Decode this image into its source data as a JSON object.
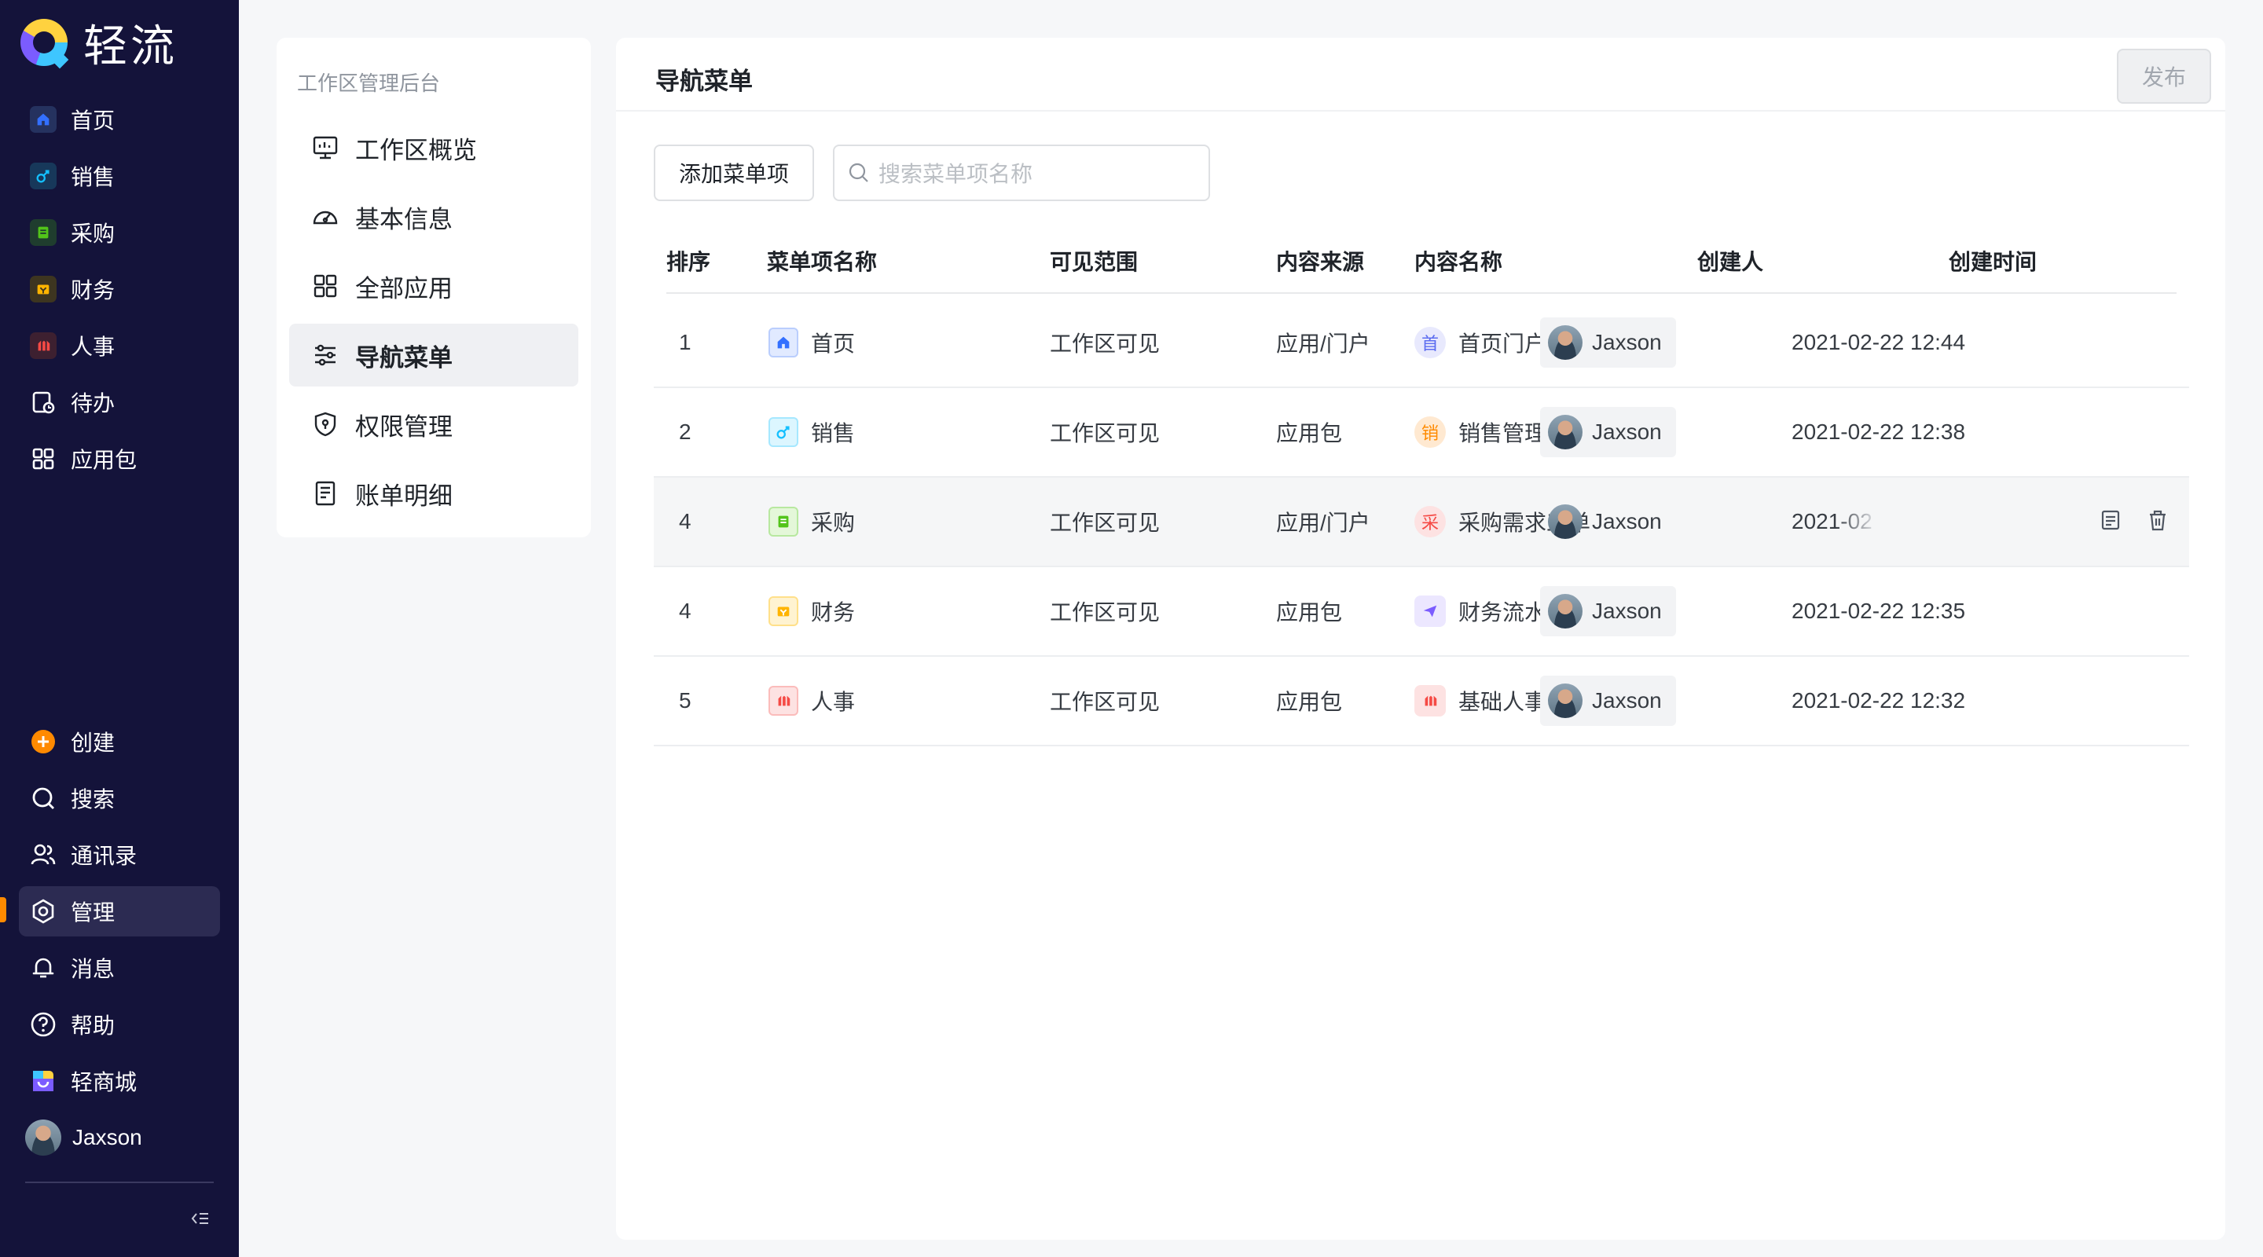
{
  "app": {
    "name": "轻流"
  },
  "sidebar": {
    "top_items": [
      {
        "label": "首页",
        "icon": "home-icon",
        "color": "#3370ff"
      },
      {
        "label": "销售",
        "icon": "sales-icon",
        "color": "#14c0ff"
      },
      {
        "label": "采购",
        "icon": "purchase-icon",
        "color": "#52c41a"
      },
      {
        "label": "财务",
        "icon": "finance-icon",
        "color": "#ffb400"
      },
      {
        "label": "人事",
        "icon": "hr-icon",
        "color": "#f54a45"
      },
      {
        "label": "待办",
        "icon": "todo-icon"
      },
      {
        "label": "应用包",
        "icon": "app-package-icon"
      }
    ],
    "bottom_items": [
      {
        "label": "创建",
        "icon": "create-icon",
        "color": "#ff8a00"
      },
      {
        "label": "搜索",
        "icon": "search-icon"
      },
      {
        "label": "通讯录",
        "icon": "contacts-icon"
      },
      {
        "label": "管理",
        "icon": "manage-icon",
        "active": true
      },
      {
        "label": "消息",
        "icon": "bell-icon"
      },
      {
        "label": "帮助",
        "icon": "help-icon"
      },
      {
        "label": "轻商城",
        "icon": "store-icon"
      }
    ],
    "user": {
      "name": "Jaxson"
    }
  },
  "subnav": {
    "title": "工作区管理后台",
    "items": [
      {
        "label": "工作区概览",
        "icon": "overview-icon"
      },
      {
        "label": "基本信息",
        "icon": "dashboard-icon"
      },
      {
        "label": "全部应用",
        "icon": "grid-icon"
      },
      {
        "label": "导航菜单",
        "icon": "sliders-icon",
        "active": true
      },
      {
        "label": "权限管理",
        "icon": "shield-icon"
      },
      {
        "label": "账单明细",
        "icon": "bill-icon"
      }
    ]
  },
  "main": {
    "title": "导航菜单",
    "publish_label": "发布",
    "add_label": "添加菜单项",
    "search_placeholder": "搜索菜单项名称",
    "columns": [
      "排序",
      "菜单项名称",
      "可见范围",
      "内容来源",
      "内容名称",
      "创建人",
      "创建时间"
    ],
    "rows": [
      {
        "order": "1",
        "name": "首页",
        "icon": "home-icon",
        "color": "#3370ff",
        "visibility": "工作区可见",
        "source": "应用/门户",
        "content": "首页门户",
        "content_badge": "首",
        "badge_color": "#5b6cf0",
        "creator": "Jaxson",
        "time": "2021-02-22 12:44"
      },
      {
        "order": "2",
        "name": "销售",
        "icon": "sales-icon",
        "color": "#14c0ff",
        "visibility": "工作区可见",
        "source": "应用包",
        "content": "销售管理",
        "content_badge": "销",
        "badge_color": "#ff8a00",
        "creator": "Jaxson",
        "time": "2021-02-22 12:38"
      },
      {
        "order": "4",
        "name": "采购",
        "icon": "purchase-icon",
        "color": "#52c41a",
        "visibility": "工作区可见",
        "source": "应用/门户",
        "content": "采购需求工单",
        "content_badge": "采",
        "badge_color": "#f54a45",
        "creator": "Jaxson",
        "time": "2021-02",
        "hover": true
      },
      {
        "order": "4",
        "name": "财务",
        "icon": "finance-icon",
        "color": "#ffb400",
        "visibility": "工作区可见",
        "source": "应用包",
        "content": "财务流水",
        "content_badge": "",
        "badge_color": "#7b5cff",
        "creator": "Jaxson",
        "time": "2021-02-22 12:35"
      },
      {
        "order": "5",
        "name": "人事",
        "icon": "hr-icon",
        "color": "#f54a45",
        "visibility": "工作区可见",
        "source": "应用包",
        "content": "基础人事管理",
        "content_badge": "",
        "badge_color": "#f54a45",
        "creator": "Jaxson",
        "time": "2021-02-22 12:32"
      }
    ]
  }
}
